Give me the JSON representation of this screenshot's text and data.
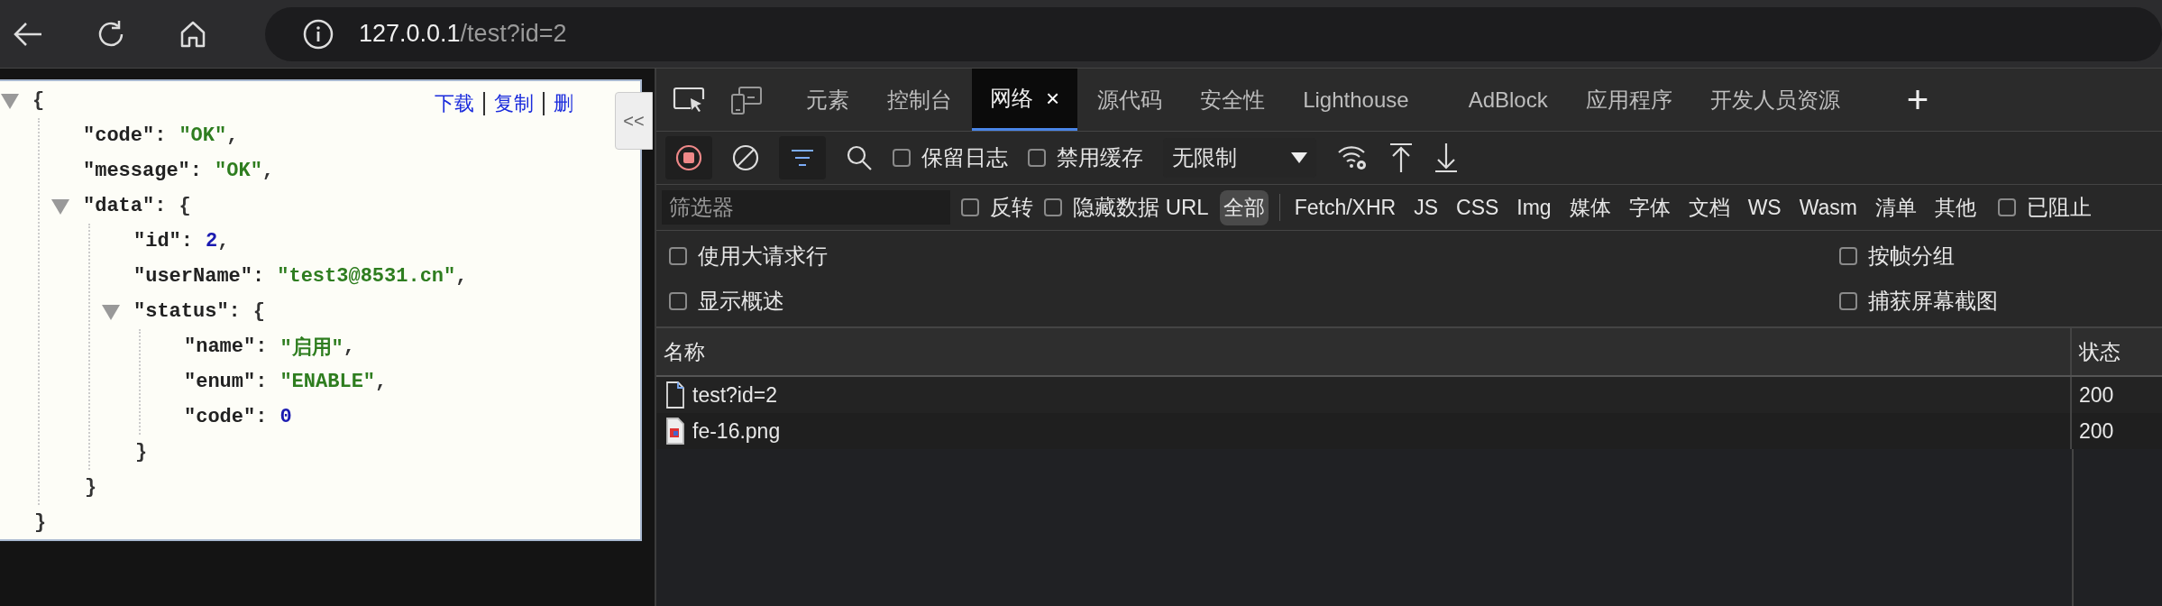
{
  "address_bar": {
    "host": "127.0.0.1",
    "path": "/test?id=2"
  },
  "json_viewer": {
    "actions": [
      "下载",
      "复制",
      "删"
    ],
    "collapse_button": "<<",
    "root": {
      "open": "{",
      "close": "}",
      "expanded": true,
      "children": [
        {
          "key": "\"code\":",
          "value": "\"OK\"",
          "end": ",",
          "kind": "string"
        },
        {
          "key": "\"message\":",
          "value": "\"OK\"",
          "end": ",",
          "kind": "string"
        },
        {
          "key": "\"data\":",
          "open": "{",
          "close": "}",
          "expanded": true,
          "children": [
            {
              "key": "\"id\":",
              "value": "2",
              "end": ",",
              "kind": "number"
            },
            {
              "key": "\"userName\":",
              "value": "\"test3@8531.cn\"",
              "end": ",",
              "kind": "string"
            },
            {
              "key": "\"status\":",
              "open": "{",
              "close": "}",
              "expanded": true,
              "children": [
                {
                  "key": "\"name\":",
                  "value": "\"启用\"",
                  "end": ",",
                  "kind": "string"
                },
                {
                  "key": "\"enum\":",
                  "value": "\"ENABLE\"",
                  "end": ",",
                  "kind": "string"
                },
                {
                  "key": "\"code\":",
                  "value": "0",
                  "kind": "number"
                }
              ]
            }
          ]
        }
      ]
    }
  },
  "devtools": {
    "tabs": [
      {
        "label": "元素",
        "selected": false
      },
      {
        "label": "控制台",
        "selected": false
      },
      {
        "label": "网络",
        "selected": true,
        "close": "×"
      },
      {
        "label": "源代码",
        "selected": false
      },
      {
        "label": "安全性",
        "selected": false
      },
      {
        "label": "Lighthouse",
        "selected": false
      },
      {
        "label": "AdBlock",
        "selected": false
      },
      {
        "label": "应用程序",
        "selected": false
      },
      {
        "label": "开发人员资源",
        "selected": false
      }
    ],
    "add_tab": "+",
    "toolbar": {
      "recording": true,
      "filter_active": true,
      "checkboxes": [
        {
          "label": "保留日志",
          "checked": false
        },
        {
          "label": "禁用缓存",
          "checked": false
        }
      ],
      "throttling": "无限制"
    },
    "filter": {
      "placeholder": "筛选器",
      "checkboxes": [
        {
          "label": "反转",
          "checked": false
        },
        {
          "label": "隐藏数据 URL",
          "checked": false
        }
      ],
      "types": [
        {
          "label": "全部",
          "selected": true
        },
        {
          "label": "Fetch/XHR",
          "selected": false
        },
        {
          "label": "JS",
          "selected": false
        },
        {
          "label": "CSS",
          "selected": false
        },
        {
          "label": "Img",
          "selected": false
        },
        {
          "label": "媒体",
          "selected": false
        },
        {
          "label": "字体",
          "selected": false
        },
        {
          "label": "文档",
          "selected": false
        },
        {
          "label": "WS",
          "selected": false
        },
        {
          "label": "Wasm",
          "selected": false
        },
        {
          "label": "清单",
          "selected": false
        },
        {
          "label": "其他",
          "selected": false
        }
      ],
      "blocked": {
        "label": "已阻止",
        "checked": false
      }
    },
    "options": [
      {
        "label": "使用大请求行",
        "checked": false
      },
      {
        "label": "按帧分组",
        "checked": false
      },
      {
        "label": "显示概述",
        "checked": false
      },
      {
        "label": "捕获屏幕截图",
        "checked": false
      }
    ],
    "table": {
      "columns": [
        "名称",
        "状态"
      ],
      "rows": [
        {
          "name": "test?id=2",
          "status": "200",
          "kind": "document"
        },
        {
          "name": "fe-16.png",
          "status": "200",
          "kind": "image"
        }
      ]
    }
  }
}
